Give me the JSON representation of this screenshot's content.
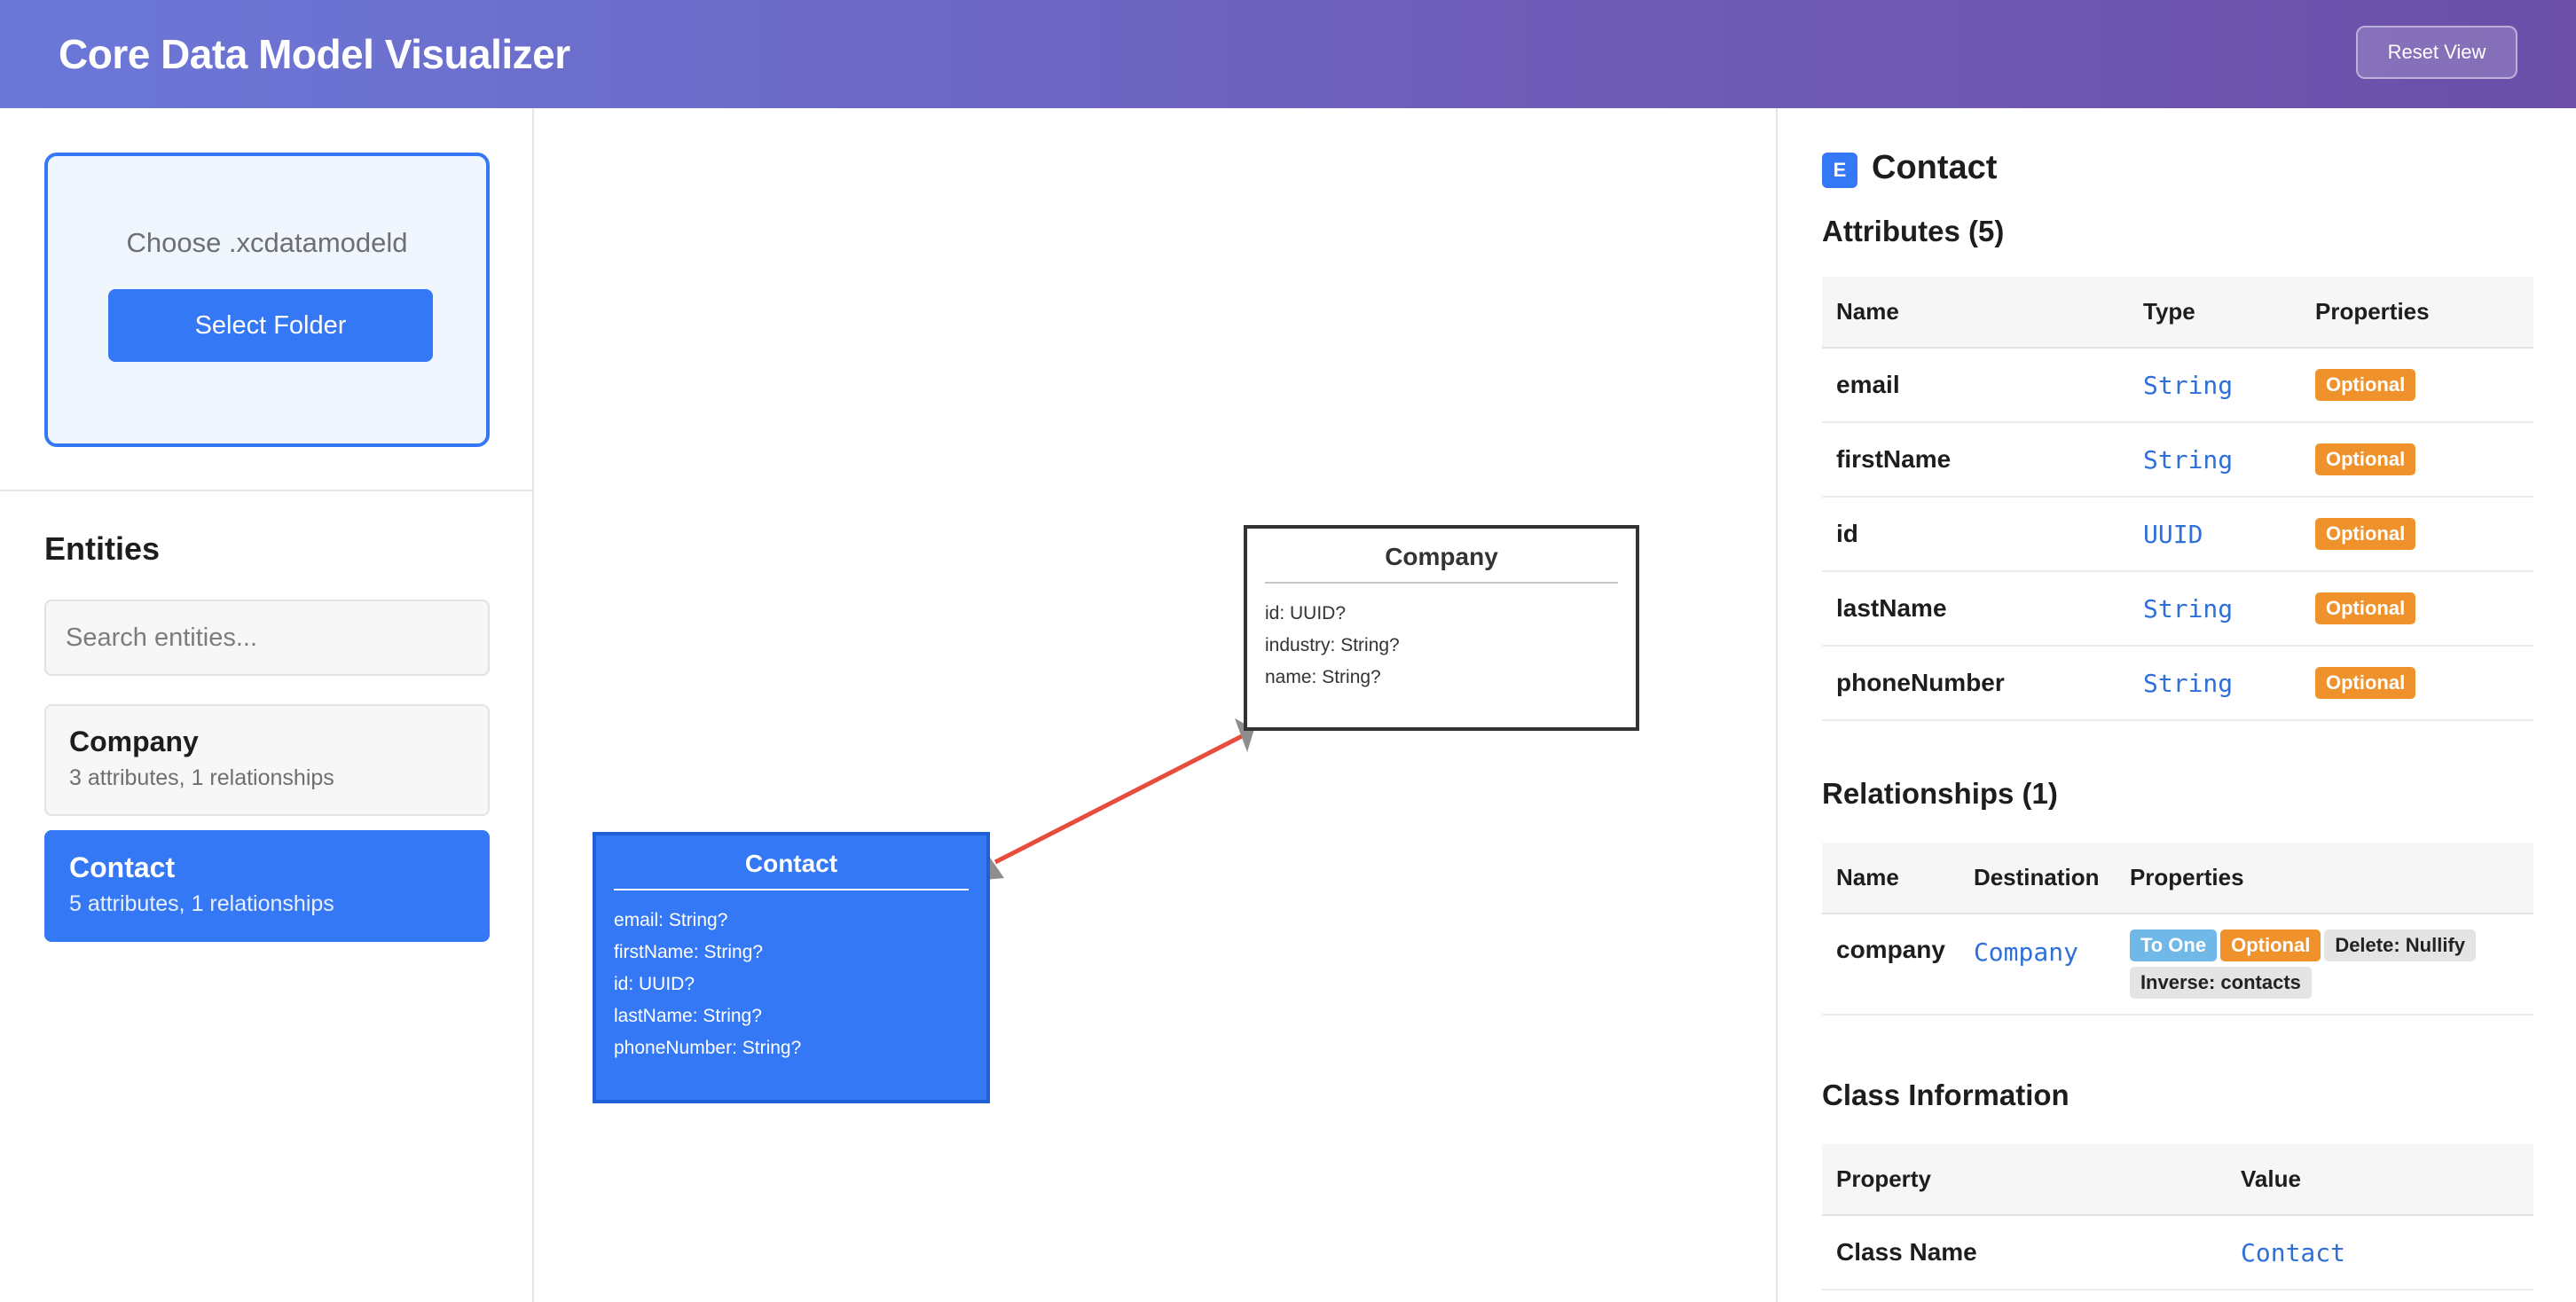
{
  "header": {
    "title": "Core Data Model Visualizer",
    "reset_label": "Reset View"
  },
  "sidebar": {
    "drop_label": "Choose .xcdatamodeld",
    "select_button": "Select Folder",
    "entities_title": "Entities",
    "search_placeholder": "Search entities...",
    "entities": [
      {
        "name": "Company",
        "meta": "3 attributes, 1 relationships",
        "selected": false
      },
      {
        "name": "Contact",
        "meta": "5 attributes, 1 relationships",
        "selected": true
      }
    ]
  },
  "canvas": {
    "nodes": [
      {
        "name": "Company",
        "attrs": [
          "id: UUID?",
          "industry: String?",
          "name: String?"
        ]
      },
      {
        "name": "Contact",
        "attrs": [
          "email: String?",
          "firstName: String?",
          "id: UUID?",
          "lastName: String?",
          "phoneNumber: String?"
        ]
      }
    ],
    "edge_color": "#e74c3c",
    "arrow_color": "#8e8e8e"
  },
  "detail": {
    "badge": "E",
    "title": "Contact",
    "attributes_title": "Attributes (5)",
    "attr_headers": [
      "Name",
      "Type",
      "Properties"
    ],
    "attributes": [
      {
        "name": "email",
        "type": "String",
        "props": "Optional"
      },
      {
        "name": "firstName",
        "type": "String",
        "props": "Optional"
      },
      {
        "name": "id",
        "type": "UUID",
        "props": "Optional"
      },
      {
        "name": "lastName",
        "type": "String",
        "props": "Optional"
      },
      {
        "name": "phoneNumber",
        "type": "String",
        "props": "Optional"
      }
    ],
    "relationships_title": "Relationships (1)",
    "rel_headers": [
      "Name",
      "Destination",
      "Properties"
    ],
    "relationships": [
      {
        "name": "company",
        "destination": "Company",
        "tags": [
          "To One",
          "Optional",
          "Delete: Nullify",
          "Inverse: contacts"
        ]
      }
    ],
    "class_info_title": "Class Information",
    "class_headers": [
      "Property",
      "Value"
    ],
    "class_info": [
      {
        "property": "Class Name",
        "value": "Contact"
      }
    ]
  },
  "colors": {
    "accent": "#3478f6",
    "optional_tag": "#f0922b",
    "to_one_tag": "#6fb8e8"
  }
}
